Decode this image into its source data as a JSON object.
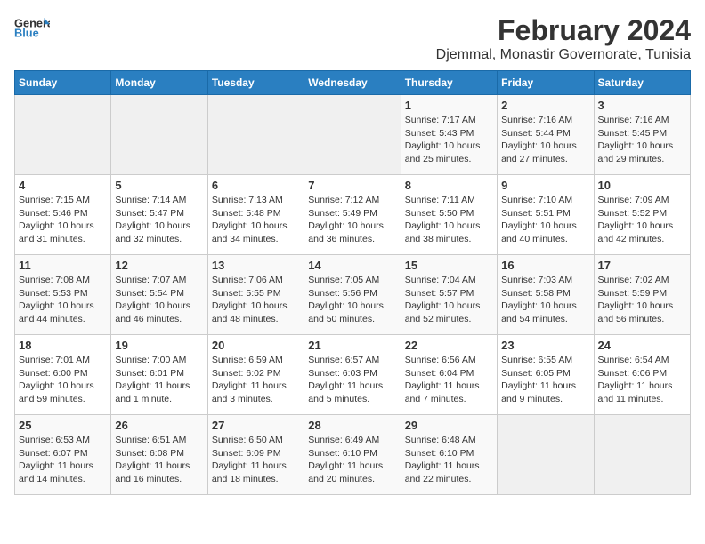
{
  "logo": {
    "general": "General",
    "blue": "Blue"
  },
  "title": "February 2024",
  "subtitle": "Djemmal, Monastir Governorate, Tunisia",
  "weekdays": [
    "Sunday",
    "Monday",
    "Tuesday",
    "Wednesday",
    "Thursday",
    "Friday",
    "Saturday"
  ],
  "weeks": [
    [
      {
        "day": "",
        "info": ""
      },
      {
        "day": "",
        "info": ""
      },
      {
        "day": "",
        "info": ""
      },
      {
        "day": "",
        "info": ""
      },
      {
        "day": "1",
        "info": "Sunrise: 7:17 AM\nSunset: 5:43 PM\nDaylight: 10 hours\nand 25 minutes."
      },
      {
        "day": "2",
        "info": "Sunrise: 7:16 AM\nSunset: 5:44 PM\nDaylight: 10 hours\nand 27 minutes."
      },
      {
        "day": "3",
        "info": "Sunrise: 7:16 AM\nSunset: 5:45 PM\nDaylight: 10 hours\nand 29 minutes."
      }
    ],
    [
      {
        "day": "4",
        "info": "Sunrise: 7:15 AM\nSunset: 5:46 PM\nDaylight: 10 hours\nand 31 minutes."
      },
      {
        "day": "5",
        "info": "Sunrise: 7:14 AM\nSunset: 5:47 PM\nDaylight: 10 hours\nand 32 minutes."
      },
      {
        "day": "6",
        "info": "Sunrise: 7:13 AM\nSunset: 5:48 PM\nDaylight: 10 hours\nand 34 minutes."
      },
      {
        "day": "7",
        "info": "Sunrise: 7:12 AM\nSunset: 5:49 PM\nDaylight: 10 hours\nand 36 minutes."
      },
      {
        "day": "8",
        "info": "Sunrise: 7:11 AM\nSunset: 5:50 PM\nDaylight: 10 hours\nand 38 minutes."
      },
      {
        "day": "9",
        "info": "Sunrise: 7:10 AM\nSunset: 5:51 PM\nDaylight: 10 hours\nand 40 minutes."
      },
      {
        "day": "10",
        "info": "Sunrise: 7:09 AM\nSunset: 5:52 PM\nDaylight: 10 hours\nand 42 minutes."
      }
    ],
    [
      {
        "day": "11",
        "info": "Sunrise: 7:08 AM\nSunset: 5:53 PM\nDaylight: 10 hours\nand 44 minutes."
      },
      {
        "day": "12",
        "info": "Sunrise: 7:07 AM\nSunset: 5:54 PM\nDaylight: 10 hours\nand 46 minutes."
      },
      {
        "day": "13",
        "info": "Sunrise: 7:06 AM\nSunset: 5:55 PM\nDaylight: 10 hours\nand 48 minutes."
      },
      {
        "day": "14",
        "info": "Sunrise: 7:05 AM\nSunset: 5:56 PM\nDaylight: 10 hours\nand 50 minutes."
      },
      {
        "day": "15",
        "info": "Sunrise: 7:04 AM\nSunset: 5:57 PM\nDaylight: 10 hours\nand 52 minutes."
      },
      {
        "day": "16",
        "info": "Sunrise: 7:03 AM\nSunset: 5:58 PM\nDaylight: 10 hours\nand 54 minutes."
      },
      {
        "day": "17",
        "info": "Sunrise: 7:02 AM\nSunset: 5:59 PM\nDaylight: 10 hours\nand 56 minutes."
      }
    ],
    [
      {
        "day": "18",
        "info": "Sunrise: 7:01 AM\nSunset: 6:00 PM\nDaylight: 10 hours\nand 59 minutes."
      },
      {
        "day": "19",
        "info": "Sunrise: 7:00 AM\nSunset: 6:01 PM\nDaylight: 11 hours\nand 1 minute."
      },
      {
        "day": "20",
        "info": "Sunrise: 6:59 AM\nSunset: 6:02 PM\nDaylight: 11 hours\nand 3 minutes."
      },
      {
        "day": "21",
        "info": "Sunrise: 6:57 AM\nSunset: 6:03 PM\nDaylight: 11 hours\nand 5 minutes."
      },
      {
        "day": "22",
        "info": "Sunrise: 6:56 AM\nSunset: 6:04 PM\nDaylight: 11 hours\nand 7 minutes."
      },
      {
        "day": "23",
        "info": "Sunrise: 6:55 AM\nSunset: 6:05 PM\nDaylight: 11 hours\nand 9 minutes."
      },
      {
        "day": "24",
        "info": "Sunrise: 6:54 AM\nSunset: 6:06 PM\nDaylight: 11 hours\nand 11 minutes."
      }
    ],
    [
      {
        "day": "25",
        "info": "Sunrise: 6:53 AM\nSunset: 6:07 PM\nDaylight: 11 hours\nand 14 minutes."
      },
      {
        "day": "26",
        "info": "Sunrise: 6:51 AM\nSunset: 6:08 PM\nDaylight: 11 hours\nand 16 minutes."
      },
      {
        "day": "27",
        "info": "Sunrise: 6:50 AM\nSunset: 6:09 PM\nDaylight: 11 hours\nand 18 minutes."
      },
      {
        "day": "28",
        "info": "Sunrise: 6:49 AM\nSunset: 6:10 PM\nDaylight: 11 hours\nand 20 minutes."
      },
      {
        "day": "29",
        "info": "Sunrise: 6:48 AM\nSunset: 6:10 PM\nDaylight: 11 hours\nand 22 minutes."
      },
      {
        "day": "",
        "info": ""
      },
      {
        "day": "",
        "info": ""
      }
    ]
  ]
}
